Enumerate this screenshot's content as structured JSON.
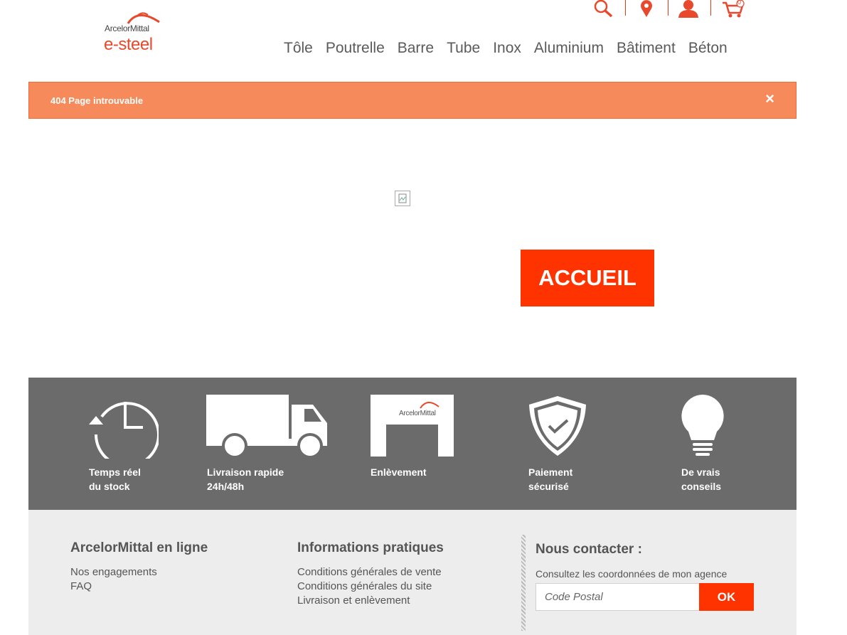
{
  "header": {
    "brand": "ArcelorMittal",
    "logo_sub": "e-steel",
    "icons": [
      "search-icon",
      "location-icon",
      "user-icon",
      "cart-icon"
    ],
    "cart_count": "0",
    "nav": [
      "Tôle",
      "Poutrelle",
      "Barre",
      "Tube",
      "Inox",
      "Aluminium",
      "Bâtiment",
      "Béton"
    ]
  },
  "alert": {
    "message": "404 Page introuvable",
    "close": "×"
  },
  "main": {
    "home_button": "ACCUEIL"
  },
  "features": [
    {
      "icon": "clock-icon",
      "line1": "Temps réel",
      "line2": "du stock"
    },
    {
      "icon": "truck-icon",
      "line1": "Livraison rapide",
      "line2": "24h/48h"
    },
    {
      "icon": "warehouse-icon",
      "line1": "Enlèvement",
      "line2": "",
      "brand": "ArcelorMittal"
    },
    {
      "icon": "shield-check-icon",
      "line1": "Paiement",
      "line2": "sécurisé"
    },
    {
      "icon": "lightbulb-icon",
      "line1": "De vrais",
      "line2": "conseils"
    }
  ],
  "footer": {
    "col1": {
      "title": "ArcelorMittal en ligne",
      "links": [
        "Nos engagements",
        "FAQ"
      ]
    },
    "col2": {
      "title": "Informations pratiques",
      "links": [
        "Conditions générales de vente",
        "Conditions générales du site",
        "Livraison et enlèvement"
      ]
    },
    "contact": {
      "title": "Nous contacter :",
      "subtitle": "Consultez les coordonnées de mon agence",
      "placeholder": "Code Postal",
      "button": "OK"
    }
  },
  "colors": {
    "accent": "#ff3300",
    "alert_bg": "#f68a5b",
    "band_bg": "#6b6b6b",
    "footer_bg": "#ededed"
  }
}
